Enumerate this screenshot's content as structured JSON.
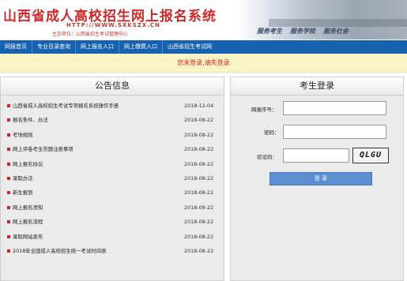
{
  "header": {
    "title": "山西省成人高校招生网上报名系统",
    "url": "HTTP://WWW.SXKSZX.CN",
    "sponsor": "主办单位：山西省招生考试管理中心",
    "slogans": [
      "服务考生",
      "服务学校",
      "服务社会"
    ]
  },
  "nav": {
    "items": [
      {
        "label": "网报首页"
      },
      {
        "label": "专业目录查询"
      },
      {
        "label": "网上报名入口"
      },
      {
        "label": "网上缴费入口"
      },
      {
        "label": "山西省招生考试网"
      }
    ]
  },
  "notice": {
    "text": "您未登录,请先登录"
  },
  "announcements": {
    "title": "公告信息",
    "items": [
      {
        "title": "山西省成人高校招生考试专项报名系统操作手册",
        "date": "2018-12-04"
      },
      {
        "title": "报名条件、办法",
        "date": "2018-08-22"
      },
      {
        "title": "考场规则",
        "date": "2018-08-22"
      },
      {
        "title": "网上评卷考生答题注意事项",
        "date": "2018-08-22"
      },
      {
        "title": "网上报名协议",
        "date": "2018-08-22"
      },
      {
        "title": "录取办法",
        "date": "2018-08-22"
      },
      {
        "title": "新生报到",
        "date": "2018-08-22"
      },
      {
        "title": "网上报名须知",
        "date": "2018-08-22"
      },
      {
        "title": "网上报名流程",
        "date": "2018-08-22"
      },
      {
        "title": "录取网站发布",
        "date": "2018-08-22"
      },
      {
        "title": "2018年全国成人高校招生统一考试时间表",
        "date": "2018-08-22"
      }
    ]
  },
  "login": {
    "title": "考生登录",
    "reg_label": "网报序号：",
    "reg_value": "",
    "password_label": "密码：",
    "password_value": "",
    "captcha_label": "验证码：",
    "captcha_value": "",
    "captcha_text": "QLGU",
    "submit_label": "登 录"
  },
  "colors": {
    "nav_bg": "#1662b0",
    "notice_bg": "#fbf4c6",
    "notice_text": "#e02020",
    "title_red": "#cc2a2a",
    "button_blue": "#5b8fd2",
    "bullet_red": "#d32222"
  }
}
